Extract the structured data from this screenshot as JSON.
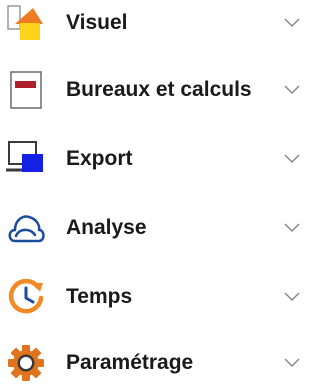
{
  "menu": {
    "items": [
      {
        "label": "Visuel",
        "icon": "visual-shapes-icon"
      },
      {
        "label": "Bureaux et calculs",
        "icon": "desktop-window-icon"
      },
      {
        "label": "Export",
        "icon": "export-monitor-icon"
      },
      {
        "label": "Analyse",
        "icon": "cloud-analysis-icon"
      },
      {
        "label": "Temps",
        "icon": "clock-icon"
      },
      {
        "label": "Paramétrage",
        "icon": "settings-gear-icon"
      }
    ],
    "chevron_icon": "chevron-down-icon",
    "colors": {
      "text": "#1a1a1a",
      "chevron": "#8a8a8a",
      "visual_orange": "#f07c21",
      "visual_yellow": "#fdd31c",
      "desktop_red": "#b0202a",
      "export_blue": "#1420e6",
      "analysis_blue": "#1a4d9c",
      "time_orange": "#f08a24",
      "settings_orange": "#e0731c"
    }
  }
}
